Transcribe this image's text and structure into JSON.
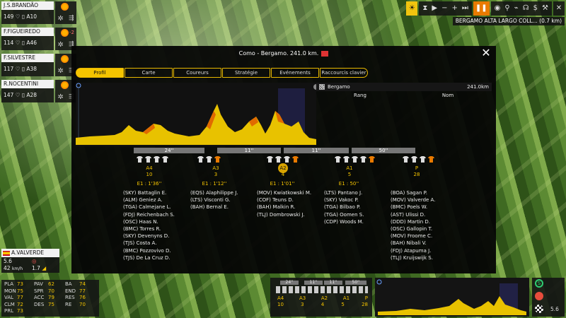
{
  "riders": [
    {
      "name": "J.S.BRANDÃO",
      "hp": "149",
      "num": "A10",
      "tag": "",
      "tag_color": ""
    },
    {
      "name": "F.FIGUEIREDO",
      "hp": "114",
      "num": "A46",
      "tag": "-2",
      "tag_color": "#ff6b6b"
    },
    {
      "name": "F.SILVESTRE",
      "hp": "117",
      "num": "A38",
      "tag": "",
      "tag_color": ""
    },
    {
      "name": "R.NOCENTINI",
      "hp": "147",
      "num": "A28",
      "tag": "",
      "tag_color": ""
    }
  ],
  "toolbar": {
    "location": "BERGAMO ALTA LARGO COLL... (0.7 km)"
  },
  "modal": {
    "title": "Como - Bergamo. 241.0 km.",
    "close": "✕",
    "tabs": [
      "Profil",
      "Carte",
      "Coureurs",
      "Stratégie",
      "Evénements",
      "Raccourcis clavier"
    ],
    "active_tab": "Profil",
    "finish": "Bergamo",
    "finish_dist": "241.0km",
    "col_rank": "Rang",
    "col_name": "Nom",
    "gaps": [
      "24''",
      "11''",
      "11''",
      "50''"
    ],
    "groups": [
      {
        "label": "A4",
        "count": "10",
        "gap": "E1 : 1'36''",
        "riders": [
          "(SKY) Battaglin E.",
          "(ALM) Geniez A.",
          "(TGA) Calmejane L.",
          "(FDJ) Reichenbach S.",
          "(OSC) Haas N.",
          "(BMC) Torres R.",
          "(SKY) Devenyns D.",
          "(TJS) Costa A.",
          "(BMC) Pozzovivo D.",
          "(TJS) De La Cruz D."
        ]
      },
      {
        "label": "A3",
        "count": "3",
        "gap": "E1 : 1'12''",
        "riders": [
          "(EQS) Alaphilippe J.",
          "(LTS) Visconti G.",
          "(BAH) Bernal E."
        ]
      },
      {
        "label": "A2",
        "count": "4",
        "gap": "E1 : 1'01''",
        "riders": [
          "(MOV) Kwiatkowski M.",
          "(COF) Teuns D.",
          "(BAH) Malkin R.",
          "(TLJ) Dombrowski J."
        ]
      },
      {
        "label": "A1",
        "count": "5",
        "gap": "E1 : 50''",
        "riders": [
          "(LTS) Pantano J.",
          "(SKY) Vakoc P.",
          "(TGA) Bilbao P.",
          "(TGA) Oomen S.",
          "(CDP) Woods M."
        ]
      },
      {
        "label": "P",
        "count": "28",
        "gap": "",
        "riders": [
          "(BOA) Sagan P.",
          "(MOV) Valverde A.",
          "(BMC) Poels W.",
          "(AST) Ulissi D.",
          "(DDD) Martin D.",
          "(OSC) Gallopin T.",
          "(MOV) Froome C.",
          "(BAH) Nibali V.",
          "(FDJ) Atapuma J.",
          "(TLJ) Kruijswijk S."
        ]
      }
    ]
  },
  "current_rider": {
    "name": "A.VALVERDE",
    "speed": "5.6",
    "kmh": "42",
    "kmh_unit": "km/h",
    "grade": "1.7"
  },
  "attributes": [
    [
      "PLA",
      "73",
      "PAV",
      "62",
      "BA",
      "74"
    ],
    [
      "MON",
      "75",
      "SPR",
      "70",
      "END",
      "77"
    ],
    [
      "VAL",
      "77",
      "ACC",
      "79",
      "RES",
      "76"
    ],
    [
      "CLM",
      "72",
      "DES",
      "75",
      "RE",
      "70"
    ],
    [
      "PRL",
      "73",
      "",
      "",
      "",
      ""
    ]
  ],
  "mini": {
    "gaps": [
      "24''",
      "11''",
      "11''",
      "50''"
    ],
    "labels": [
      "A4",
      "A3",
      "A2",
      "A1",
      "P"
    ],
    "counts": [
      "10",
      "3",
      "4",
      "5",
      "28"
    ]
  },
  "bottom_right": {
    "value": "5.6"
  }
}
